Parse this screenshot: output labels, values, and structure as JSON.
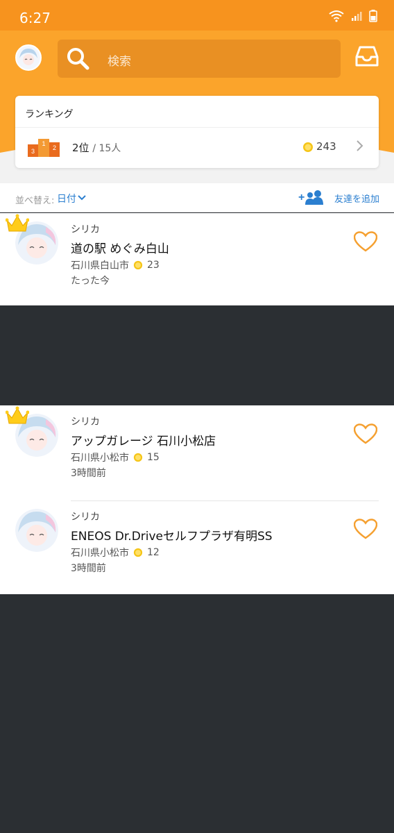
{
  "status_bar": {
    "time": "6:27"
  },
  "header": {
    "search_placeholder": "検索"
  },
  "ranking": {
    "title": "ランキング",
    "rank": "2位",
    "total": "/ 15人",
    "points": "243",
    "podium_labels": [
      "3",
      "1",
      "2"
    ]
  },
  "sort": {
    "label": "並べ替え:",
    "value": "日付",
    "add_friend": "友達を追加"
  },
  "posts": [
    {
      "user": "シリカ",
      "title": "道の駅 めぐみ白山",
      "location": "石川県白山市",
      "points": "23",
      "time": "たった今",
      "crown": true
    },
    {
      "user": "シリカ",
      "title": "アップガレージ 石川小松店",
      "location": "石川県小松市",
      "points": "15",
      "time": "3時間前",
      "crown": true
    },
    {
      "user": "シリカ",
      "title": "ENEOS Dr.Driveセルフプラザ有明SS",
      "location": "石川県小松市",
      "points": "12",
      "time": "3時間前",
      "crown": false
    }
  ],
  "colors": {
    "accent": "#fba42b",
    "link": "#2b7fd0",
    "dark_bg": "#2b2f33"
  }
}
